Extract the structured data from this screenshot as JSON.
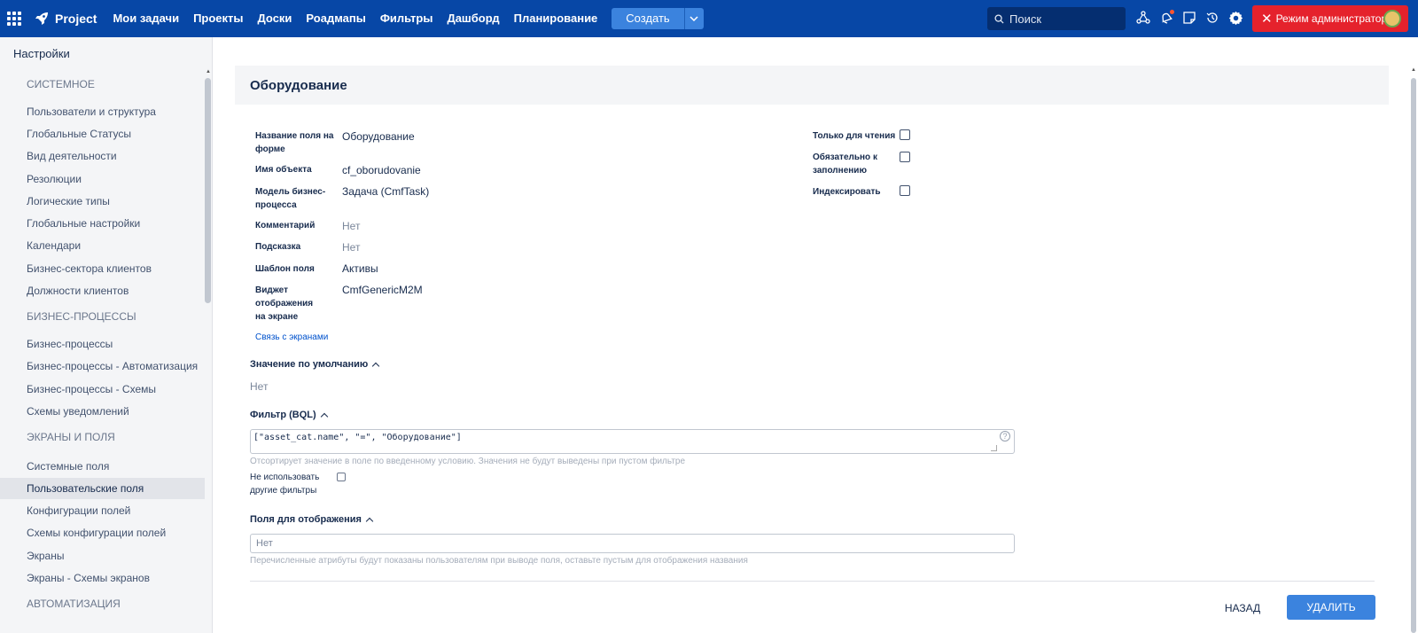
{
  "topbar": {
    "logo": "Project",
    "nav": [
      "Мои задачи",
      "Проекты",
      "Доски",
      "Роадмапы",
      "Фильтры",
      "Дашборд",
      "Планирование"
    ],
    "create_label": "Создать",
    "search_placeholder": "Поиск",
    "admin_label": "Режим администратора",
    "colors": {
      "bar": "#0747a6",
      "admin": "#e5222c",
      "create": "#3b83de"
    }
  },
  "sidebar": {
    "title": "Настройки",
    "sections": [
      {
        "title": "СИСТЕМНОЕ",
        "items": [
          "Пользователи и структура",
          "Глобальные Статусы",
          "Вид деятельности",
          "Резолюции",
          "Логические типы",
          "Глобальные настройки",
          "Календари",
          "Бизнес-сектора клиентов",
          "Должности клиентов"
        ]
      },
      {
        "title": "БИЗНЕС-ПРОЦЕССЫ",
        "items": [
          "Бизнес-процессы",
          "Бизнес-процессы - Автоматизация",
          "Бизнес-процессы - Схемы",
          "Схемы уведомлений"
        ]
      },
      {
        "title": "ЭКРАНЫ И ПОЛЯ",
        "items": [
          "Системные поля",
          "Пользовательские поля",
          "Конфигурации полей",
          "Схемы конфигурации полей",
          "Экраны",
          "Экраны - Схемы экранов"
        ]
      },
      {
        "title": "АВТОМАТИЗАЦИЯ",
        "items": []
      }
    ],
    "active_item": "Пользовательские поля"
  },
  "main": {
    "title": "Оборудование",
    "fields": [
      {
        "label": "Название поля на форме",
        "value": "Оборудование"
      },
      {
        "label": "Имя объекта",
        "value": "cf_oborudovanie"
      },
      {
        "label": "Модель бизнес-процесса",
        "value": "Задача (CmfTask)"
      },
      {
        "label": "Комментарий",
        "value": "Нет"
      },
      {
        "label": "Подсказка",
        "value": "Нет"
      },
      {
        "label": "Шаблон поля",
        "value": "Активы"
      },
      {
        "label": "Виджет отображения на экране",
        "value": "CmfGenericM2M"
      }
    ],
    "flags": [
      {
        "label": "Только для чтения",
        "checked": false
      },
      {
        "label": "Обязательно к заполнению",
        "checked": false
      },
      {
        "label": "Индексировать",
        "checked": false
      }
    ],
    "screens_link": "Связь с экранами",
    "default_section": {
      "title": "Значение по умолчанию",
      "value": "Нет"
    },
    "filter_section": {
      "title": "Фильтр (BQL)",
      "value": "[\"asset_cat.name\", \"=\", \"Оборудование\"]",
      "hint": "Отсортирует значение в поле по введенному условию. Значения не будут выведены при пустом фильтре",
      "no_other_filters_label": "Не использовать другие фильтры",
      "no_other_filters_checked": false
    },
    "display_section": {
      "title": "Поля для отображения",
      "value": "Нет",
      "hint": "Перечисленные атрибуты будут показаны пользователям при выводе поля, оставьте пустым для отображения названия"
    },
    "buttons": {
      "back": "НАЗАД",
      "delete": "УДАЛИТЬ"
    }
  }
}
